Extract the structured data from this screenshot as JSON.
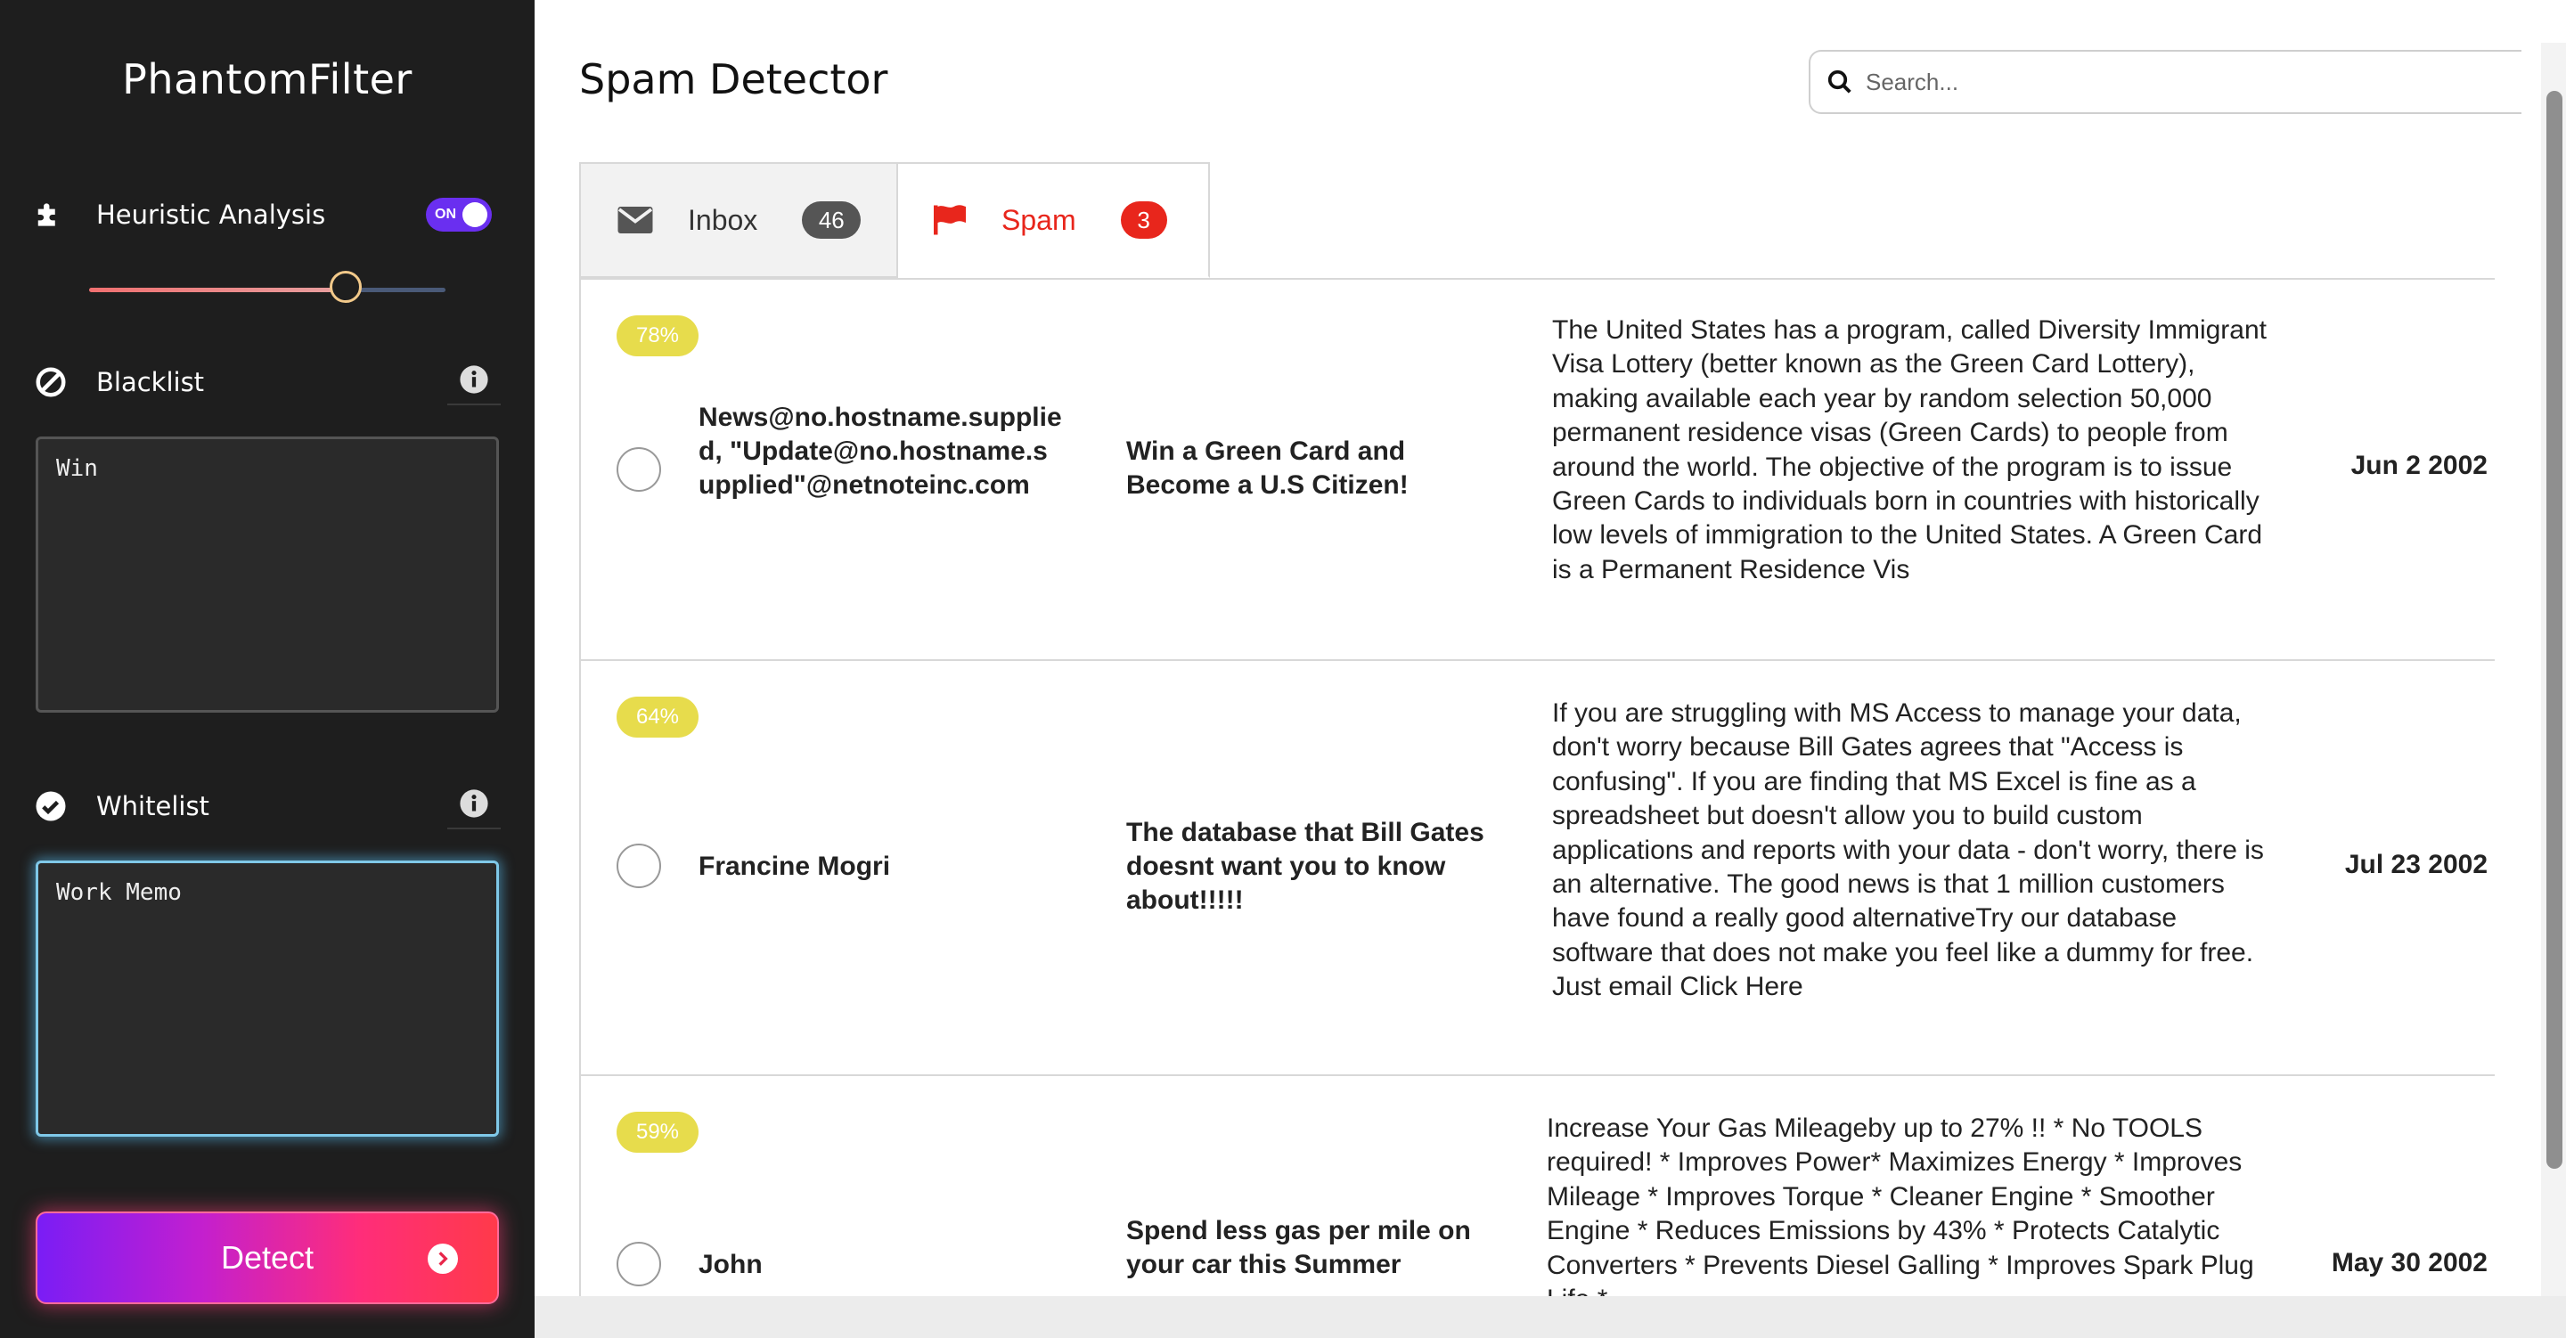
{
  "sidebar": {
    "brand": "PhantomFilter",
    "heuristic": {
      "label": "Heuristic Analysis",
      "toggle_text": "ON",
      "enabled": true,
      "slider_level": 0.72
    },
    "blacklist": {
      "label": "Blacklist",
      "value": "Win"
    },
    "whitelist": {
      "label": "Whitelist",
      "value": "Work Memo"
    },
    "detect_label": "Detect"
  },
  "main": {
    "title": "Spam Detector",
    "search": {
      "placeholder": "Search..."
    },
    "tabs": [
      {
        "label": "Inbox",
        "count": "46"
      },
      {
        "label": "Spam",
        "count": "3"
      }
    ],
    "emails": [
      {
        "score": "78%",
        "from": "News@no.hostname.supplied, \"Update@no.hostname.supplied\"@netnoteinc.com",
        "subject": "Win a Green Card and Become a U.S Citizen!",
        "body": "The United States has a program, called Diversity Immigrant Visa Lottery (better known as the Green Card Lottery), making available each year by random selection 50,000 permanent residence visas (Green Cards) to people from around the world. The objective of the program is to issue Green Cards to individuals born in countries with historically low levels of immigration to the United States. A Green Card is a Permanent Residence Vis",
        "date": "Jun 2 2002"
      },
      {
        "score": "64%",
        "from": "Francine Mogri",
        "subject": "The database that Bill Gates doesnt want you to know about!!!!!",
        "body": "If you are struggling with MS Access to manage your data, don't worry because Bill Gates agrees that \"Access is confusing\". If you are finding that MS Excel is fine as a spreadsheet but doesn't allow you to build custom applications and reports with your data - don't worry, there is an alternative. The good news is that 1 million customers have found a really good alternativeTry our database software that does not make you feel like a dummy for free. Just email Click Here",
        "date": "Jul 23 2002"
      },
      {
        "score": "59%",
        "from": "John",
        "subject": "Spend less gas per mile on your car this Summer",
        "body": " Increase Your Gas Mileageby up to 27% !! * No TOOLS required! * Improves Power* Maximizes Energy * Improves Mileage * Improves Torque  * Cleaner Engine * Smoother Engine  * Reduces Emissions by 43% * Protects Catalytic Converters * Prevents Diesel Galling  * Improves Spark Plug Life *",
        "date": "May 30 2002"
      }
    ]
  },
  "colors": {
    "sidebar_bg": "#1e1e1e",
    "toggle_on": "#6a2ff0",
    "spam_red": "#e8261c",
    "score_yellow": "#e7dc4c",
    "focus_glow": "#7fc8e8"
  },
  "icons": [
    "puzzle-icon",
    "ban-icon",
    "info-icon",
    "check-circle-icon",
    "envelope-icon",
    "flag-icon",
    "search-icon",
    "arrow-right-circle-icon"
  ]
}
